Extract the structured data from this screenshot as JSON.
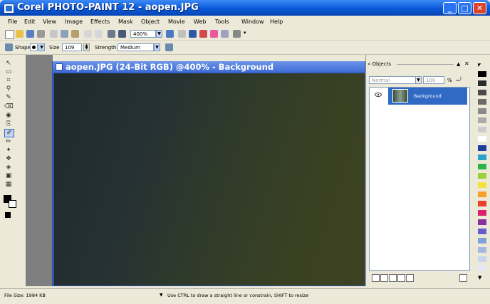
{
  "window": {
    "title": "Corel PHOTO-PAINT 12 - aopen.JPG"
  },
  "menu": {
    "items": [
      "File",
      "Edit",
      "View",
      "Image",
      "Effects",
      "Mask",
      "Object",
      "Movie",
      "Web",
      "Tools",
      "Window",
      "Help"
    ]
  },
  "toolbar": {
    "zoom_value": "400%"
  },
  "property_bar": {
    "shape_label": "Shape",
    "size_label": "Size",
    "size_value": "109",
    "strength_label": "Strength",
    "strength_value": "Medium"
  },
  "document": {
    "title": "aopen.JPG (24-Bit RGB) @400% - Background"
  },
  "objects_docker": {
    "title": "Objects",
    "blend_mode": "Normal",
    "opacity": "100",
    "opacity_unit": "%",
    "layer_name": "Background"
  },
  "status": {
    "file_size": "File Size: 1984 KB",
    "hint": "Use CTRL to draw a straight line or constrain, SHIFT to resize"
  },
  "palette": {
    "colors": [
      "#000000",
      "#2b2b2b",
      "#4a4a4a",
      "#6a6a6a",
      "#8a8a8a",
      "#aaaaaa",
      "#cccccc",
      "#ffffff",
      "#1d3e9a",
      "#2aa3c9",
      "#2bb44a",
      "#9bd23c",
      "#f4e23c",
      "#f6a12a",
      "#e8422a",
      "#d9226b",
      "#8a2fa0",
      "#6a5acd",
      "#7fa0d8",
      "#a4b8e0",
      "#c8d4ee",
      "#dfe6f4"
    ]
  }
}
